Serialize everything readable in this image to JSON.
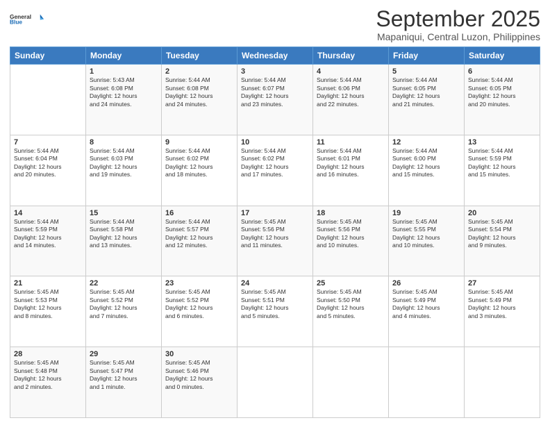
{
  "logo": {
    "line1": "General",
    "line2": "Blue"
  },
  "header": {
    "month": "September 2025",
    "location": "Mapaniqui, Central Luzon, Philippines"
  },
  "weekdays": [
    "Sunday",
    "Monday",
    "Tuesday",
    "Wednesday",
    "Thursday",
    "Friday",
    "Saturday"
  ],
  "weeks": [
    [
      {
        "day": "",
        "info": ""
      },
      {
        "day": "1",
        "info": "Sunrise: 5:43 AM\nSunset: 6:08 PM\nDaylight: 12 hours\nand 24 minutes."
      },
      {
        "day": "2",
        "info": "Sunrise: 5:44 AM\nSunset: 6:08 PM\nDaylight: 12 hours\nand 24 minutes."
      },
      {
        "day": "3",
        "info": "Sunrise: 5:44 AM\nSunset: 6:07 PM\nDaylight: 12 hours\nand 23 minutes."
      },
      {
        "day": "4",
        "info": "Sunrise: 5:44 AM\nSunset: 6:06 PM\nDaylight: 12 hours\nand 22 minutes."
      },
      {
        "day": "5",
        "info": "Sunrise: 5:44 AM\nSunset: 6:05 PM\nDaylight: 12 hours\nand 21 minutes."
      },
      {
        "day": "6",
        "info": "Sunrise: 5:44 AM\nSunset: 6:05 PM\nDaylight: 12 hours\nand 20 minutes."
      }
    ],
    [
      {
        "day": "7",
        "info": "Sunrise: 5:44 AM\nSunset: 6:04 PM\nDaylight: 12 hours\nand 20 minutes."
      },
      {
        "day": "8",
        "info": "Sunrise: 5:44 AM\nSunset: 6:03 PM\nDaylight: 12 hours\nand 19 minutes."
      },
      {
        "day": "9",
        "info": "Sunrise: 5:44 AM\nSunset: 6:02 PM\nDaylight: 12 hours\nand 18 minutes."
      },
      {
        "day": "10",
        "info": "Sunrise: 5:44 AM\nSunset: 6:02 PM\nDaylight: 12 hours\nand 17 minutes."
      },
      {
        "day": "11",
        "info": "Sunrise: 5:44 AM\nSunset: 6:01 PM\nDaylight: 12 hours\nand 16 minutes."
      },
      {
        "day": "12",
        "info": "Sunrise: 5:44 AM\nSunset: 6:00 PM\nDaylight: 12 hours\nand 15 minutes."
      },
      {
        "day": "13",
        "info": "Sunrise: 5:44 AM\nSunset: 5:59 PM\nDaylight: 12 hours\nand 15 minutes."
      }
    ],
    [
      {
        "day": "14",
        "info": "Sunrise: 5:44 AM\nSunset: 5:59 PM\nDaylight: 12 hours\nand 14 minutes."
      },
      {
        "day": "15",
        "info": "Sunrise: 5:44 AM\nSunset: 5:58 PM\nDaylight: 12 hours\nand 13 minutes."
      },
      {
        "day": "16",
        "info": "Sunrise: 5:44 AM\nSunset: 5:57 PM\nDaylight: 12 hours\nand 12 minutes."
      },
      {
        "day": "17",
        "info": "Sunrise: 5:45 AM\nSunset: 5:56 PM\nDaylight: 12 hours\nand 11 minutes."
      },
      {
        "day": "18",
        "info": "Sunrise: 5:45 AM\nSunset: 5:56 PM\nDaylight: 12 hours\nand 10 minutes."
      },
      {
        "day": "19",
        "info": "Sunrise: 5:45 AM\nSunset: 5:55 PM\nDaylight: 12 hours\nand 10 minutes."
      },
      {
        "day": "20",
        "info": "Sunrise: 5:45 AM\nSunset: 5:54 PM\nDaylight: 12 hours\nand 9 minutes."
      }
    ],
    [
      {
        "day": "21",
        "info": "Sunrise: 5:45 AM\nSunset: 5:53 PM\nDaylight: 12 hours\nand 8 minutes."
      },
      {
        "day": "22",
        "info": "Sunrise: 5:45 AM\nSunset: 5:52 PM\nDaylight: 12 hours\nand 7 minutes."
      },
      {
        "day": "23",
        "info": "Sunrise: 5:45 AM\nSunset: 5:52 PM\nDaylight: 12 hours\nand 6 minutes."
      },
      {
        "day": "24",
        "info": "Sunrise: 5:45 AM\nSunset: 5:51 PM\nDaylight: 12 hours\nand 5 minutes."
      },
      {
        "day": "25",
        "info": "Sunrise: 5:45 AM\nSunset: 5:50 PM\nDaylight: 12 hours\nand 5 minutes."
      },
      {
        "day": "26",
        "info": "Sunrise: 5:45 AM\nSunset: 5:49 PM\nDaylight: 12 hours\nand 4 minutes."
      },
      {
        "day": "27",
        "info": "Sunrise: 5:45 AM\nSunset: 5:49 PM\nDaylight: 12 hours\nand 3 minutes."
      }
    ],
    [
      {
        "day": "28",
        "info": "Sunrise: 5:45 AM\nSunset: 5:48 PM\nDaylight: 12 hours\nand 2 minutes."
      },
      {
        "day": "29",
        "info": "Sunrise: 5:45 AM\nSunset: 5:47 PM\nDaylight: 12 hours\nand 1 minute."
      },
      {
        "day": "30",
        "info": "Sunrise: 5:45 AM\nSunset: 5:46 PM\nDaylight: 12 hours\nand 0 minutes."
      },
      {
        "day": "",
        "info": ""
      },
      {
        "day": "",
        "info": ""
      },
      {
        "day": "",
        "info": ""
      },
      {
        "day": "",
        "info": ""
      }
    ]
  ]
}
